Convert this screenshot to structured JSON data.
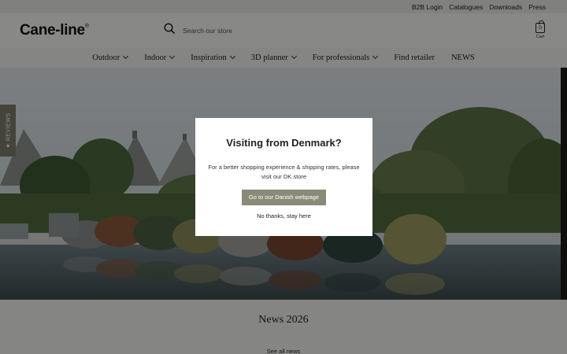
{
  "topbar": {
    "links": [
      "B2B Login",
      "Catalogues",
      "Downloads",
      "Press"
    ]
  },
  "header": {
    "logo": "Cane-line",
    "logo_mark": "®",
    "search_placeholder": "Search our store",
    "search_icon": "search-icon",
    "cart_count": "0",
    "cart_label": "Cart"
  },
  "nav": {
    "items": [
      {
        "label": "Outdoor",
        "dropdown": true
      },
      {
        "label": "Indoor",
        "dropdown": true
      },
      {
        "label": "Inspiration",
        "dropdown": true
      },
      {
        "label": "3D planner",
        "dropdown": true
      },
      {
        "label": "For professionals",
        "dropdown": true
      },
      {
        "label": "Find retailer",
        "dropdown": false
      },
      {
        "label": "NEWS",
        "dropdown": false
      }
    ]
  },
  "reviews_tab": {
    "label": "★ REVIEWS"
  },
  "modal": {
    "title": "Visiting from Denmark?",
    "body": "For a better shopping experience & shipping rates, please visit our DK store",
    "primary_button": "Go to our Danish webpage",
    "secondary_link": "No thanks, stay here"
  },
  "news": {
    "title": "News 2026",
    "link": "See all news"
  },
  "colors": {
    "accent": "#8a8a78",
    "reviews_tab": "#7d7d6a"
  }
}
